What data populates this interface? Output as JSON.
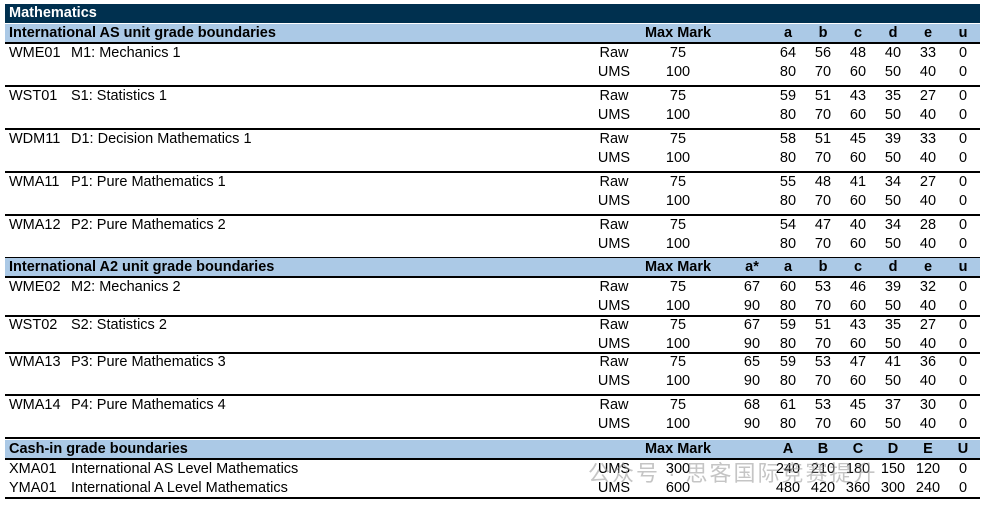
{
  "title": "Mathematics",
  "colors": {
    "title_bar": "#00304f",
    "header_bar": "#abc9e6"
  },
  "sections": [
    {
      "heading": "International AS unit grade boundaries",
      "max_mark_label": "Max Mark",
      "grades": [
        "a",
        "b",
        "c",
        "d",
        "e",
        "u"
      ],
      "units": [
        {
          "code": "WME01",
          "name": "M1: Mechanics 1",
          "rows": [
            {
              "type": "Raw",
              "max": "75",
              "values": [
                "64",
                "56",
                "48",
                "40",
                "33",
                "0"
              ]
            },
            {
              "type": "UMS",
              "max": "100",
              "values": [
                "80",
                "70",
                "60",
                "50",
                "40",
                "0"
              ]
            }
          ]
        },
        {
          "code": "WST01",
          "name": "S1: Statistics 1",
          "rows": [
            {
              "type": "Raw",
              "max": "75",
              "values": [
                "59",
                "51",
                "43",
                "35",
                "27",
                "0"
              ]
            },
            {
              "type": "UMS",
              "max": "100",
              "values": [
                "80",
                "70",
                "60",
                "50",
                "40",
                "0"
              ]
            }
          ]
        },
        {
          "code": "WDM11",
          "name": "D1: Decision Mathematics 1",
          "rows": [
            {
              "type": "Raw",
              "max": "75",
              "values": [
                "58",
                "51",
                "45",
                "39",
                "33",
                "0"
              ]
            },
            {
              "type": "UMS",
              "max": "100",
              "values": [
                "80",
                "70",
                "60",
                "50",
                "40",
                "0"
              ]
            }
          ]
        },
        {
          "code": "WMA11",
          "name": "P1: Pure Mathematics 1",
          "rows": [
            {
              "type": "Raw",
              "max": "75",
              "values": [
                "55",
                "48",
                "41",
                "34",
                "27",
                "0"
              ]
            },
            {
              "type": "UMS",
              "max": "100",
              "values": [
                "80",
                "70",
                "60",
                "50",
                "40",
                "0"
              ]
            }
          ]
        },
        {
          "code": "WMA12",
          "name": "P2: Pure Mathematics 2",
          "rows": [
            {
              "type": "Raw",
              "max": "75",
              "values": [
                "54",
                "47",
                "40",
                "34",
                "28",
                "0"
              ]
            },
            {
              "type": "UMS",
              "max": "100",
              "values": [
                "80",
                "70",
                "60",
                "50",
                "40",
                "0"
              ]
            }
          ]
        }
      ]
    },
    {
      "heading": "International A2 unit grade boundaries",
      "max_mark_label": "Max Mark",
      "grades": [
        "a*",
        "a",
        "b",
        "c",
        "d",
        "e",
        "u"
      ],
      "units": [
        {
          "code": "WME02",
          "name": "M2: Mechanics 2",
          "rows": [
            {
              "type": "Raw",
              "max": "75",
              "values": [
                "67",
                "60",
                "53",
                "46",
                "39",
                "32",
                "0"
              ]
            },
            {
              "type": "UMS",
              "max": "100",
              "values": [
                "90",
                "80",
                "70",
                "60",
                "50",
                "40",
                "0"
              ]
            }
          ]
        },
        {
          "code": "WST02",
          "name": "S2: Statistics 2",
          "rows": [
            {
              "type": "Raw",
              "max": "75",
              "values": [
                "67",
                "59",
                "51",
                "43",
                "35",
                "27",
                "0"
              ]
            },
            {
              "type": "UMS",
              "max": "100",
              "values": [
                "90",
                "80",
                "70",
                "60",
                "50",
                "40",
                "0"
              ]
            }
          ]
        },
        {
          "code": "WMA13",
          "name": "P3: Pure Mathematics 3",
          "rows": [
            {
              "type": "Raw",
              "max": "75",
              "values": [
                "65",
                "59",
                "53",
                "47",
                "41",
                "36",
                "0"
              ]
            },
            {
              "type": "UMS",
              "max": "100",
              "values": [
                "90",
                "80",
                "70",
                "60",
                "50",
                "40",
                "0"
              ]
            }
          ]
        },
        {
          "code": "WMA14",
          "name": "P4: Pure Mathematics 4",
          "rows": [
            {
              "type": "Raw",
              "max": "75",
              "values": [
                "68",
                "61",
                "53",
                "45",
                "37",
                "30",
                "0"
              ]
            },
            {
              "type": "UMS",
              "max": "100",
              "values": [
                "90",
                "80",
                "70",
                "60",
                "50",
                "40",
                "0"
              ]
            }
          ]
        }
      ]
    },
    {
      "heading": "Cash-in grade boundaries",
      "max_mark_label": "Max Mark",
      "grades": [
        "A",
        "B",
        "C",
        "D",
        "E",
        "U"
      ],
      "units": [
        {
          "code": "XMA01",
          "name": "International AS Level Mathematics",
          "rows": [
            {
              "type": "UMS",
              "max": "300",
              "values": [
                "240",
                "210",
                "180",
                "150",
                "120",
                "0"
              ]
            }
          ]
        },
        {
          "code": "YMA01",
          "name": "International A Level Mathematics",
          "rows": [
            {
              "type": "UMS",
              "max": "600",
              "values": [
                "480",
                "420",
                "360",
                "300",
                "240",
                "0"
              ]
            }
          ]
        }
      ]
    }
  ],
  "watermark": "公众号 · 思客国际竞赛提升"
}
